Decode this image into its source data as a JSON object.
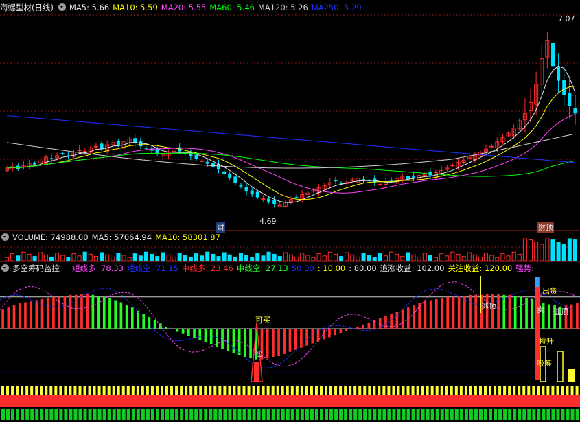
{
  "colors": {
    "up": "#ff2d2d",
    "down": "#00e0ff",
    "ma5": "#e8e8e8",
    "ma10": "#ffff00",
    "ma20": "#ff44ff",
    "ma60": "#00ff00",
    "ma120": "#cfcfcf",
    "ma250": "#2030ff",
    "grid": "#8a1a1a",
    "green": "#22ff22",
    "yellow": "#ffff33"
  },
  "price_panel": {
    "title": "海螺型材(日线)",
    "ma_items": [
      {
        "label": "MA5: 5.66",
        "color": "#e8e8e8"
      },
      {
        "label": "MA10: 5.59",
        "color": "#ffff00"
      },
      {
        "label": "MA20: 5.55",
        "color": "#ff44ff"
      },
      {
        "label": "MA60: 5.46",
        "color": "#00ff00"
      },
      {
        "label": "MA120: 5.26",
        "color": "#cfcfcf"
      },
      {
        "label": "MA250: 5.29",
        "color": "#2030ff"
      }
    ],
    "high_label": "7.07",
    "low_label": "4.69",
    "marker_left": "财",
    "marker_right": "财顶"
  },
  "volume_panel": {
    "items": [
      {
        "label": "VOLUME: 74988.00",
        "color": "#e6e6e6"
      },
      {
        "label": "MA5: 57064.94",
        "color": "#e6e6e6"
      },
      {
        "label": "MA10: 58301.87",
        "color": "#ffff00"
      }
    ]
  },
  "indicator_panel": {
    "title": "多空筹码监控",
    "items": [
      {
        "label": "短线多: 78.33",
        "color": "#ff44ff"
      },
      {
        "label": "短线空: 71.15",
        "color": "#2030ff"
      },
      {
        "label": "中线多: 23.46",
        "color": "#ff2d2d"
      },
      {
        "label": "中线空: 27.13",
        "color": "#22ff22"
      },
      {
        "label": "50.00",
        "color": "#2030ff"
      },
      {
        "label": ": 10.00",
        "color": "#ffff00"
      },
      {
        "label": ": 80.00",
        "color": "#e6e6e6"
      },
      {
        "label": "追涨收益: 102.00",
        "color": "#e6e6e6"
      },
      {
        "label": "关注收益: 120.00",
        "color": "#ffff00"
      },
      {
        "label": "强势:",
        "color": "#ff44ff"
      }
    ],
    "signals": {
      "buy_ok": "可买",
      "buy": "买",
      "escape_top": "逃顶",
      "sell_top": "出货",
      "sell": "卖",
      "escape_top2": "逃顶",
      "pull_up": "拉升",
      "absorb": "吸筹"
    }
  },
  "chart_data": [
    {
      "type": "candlestick",
      "title": "海螺型材(日线)",
      "ylim": [
        4.4,
        7.3
      ],
      "annotations": [
        {
          "text": "7.07",
          "value": 7.07
        },
        {
          "text": "4.69",
          "value": 4.69
        }
      ],
      "series": [
        {
          "name": "MA5",
          "last": 5.66
        },
        {
          "name": "MA10",
          "last": 5.59
        },
        {
          "name": "MA20",
          "last": 5.55
        },
        {
          "name": "MA60",
          "last": 5.46
        },
        {
          "name": "MA120",
          "last": 5.26
        },
        {
          "name": "MA250",
          "last": 5.29
        }
      ],
      "closes": [
        5.2,
        5.22,
        5.19,
        5.24,
        5.27,
        5.25,
        5.3,
        5.35,
        5.33,
        5.37,
        5.4,
        5.36,
        5.42,
        5.45,
        5.43,
        5.48,
        5.5,
        5.46,
        5.52,
        5.55,
        5.51,
        5.56,
        5.6,
        5.54,
        5.5,
        5.47,
        5.44,
        5.4,
        5.38,
        5.42,
        5.45,
        5.43,
        5.4,
        5.36,
        5.33,
        5.3,
        5.26,
        5.22,
        5.18,
        5.12,
        5.06,
        5.0,
        4.95,
        4.88,
        4.84,
        4.8,
        4.78,
        4.74,
        4.71,
        4.69,
        4.73,
        4.77,
        4.8,
        4.84,
        4.86,
        4.9,
        4.93,
        4.96,
        5.0,
        5.02,
        4.99,
        5.01,
        5.04,
        5.06,
        5.03,
        5.02,
        5.0,
        4.98,
        5.01,
        5.03,
        5.06,
        5.08,
        5.05,
        5.07,
        5.1,
        5.12,
        5.1,
        5.14,
        5.17,
        5.2,
        5.24,
        5.28,
        5.31,
        5.35,
        5.38,
        5.42,
        5.46,
        5.5,
        5.56,
        5.62,
        5.68,
        5.75,
        5.85,
        5.95,
        6.1,
        6.35,
        6.7,
        6.95,
        6.6,
        6.4,
        6.2,
        6.05,
        5.95
      ]
    },
    {
      "type": "bar",
      "title": "VOLUME",
      "series": [
        {
          "name": "VOLUME",
          "last": 74988.0
        },
        {
          "name": "MA5",
          "last": 57064.94
        },
        {
          "name": "MA10",
          "last": 58301.87
        }
      ]
    },
    {
      "type": "bar",
      "title": "多空筹码监控",
      "ylim": [
        0,
        100
      ],
      "series": [
        {
          "name": "短线多",
          "last": 78.33
        },
        {
          "name": "短线空",
          "last": 71.15
        },
        {
          "name": "中线多",
          "last": 23.46
        },
        {
          "name": "中线空",
          "last": 27.13
        }
      ],
      "reference_lines": [
        50,
        10,
        80
      ],
      "mid_values": [
        68,
        70,
        72,
        74,
        75,
        76,
        77,
        78,
        79,
        80,
        80,
        81,
        82,
        82,
        83,
        83,
        82,
        81,
        80,
        79,
        77,
        75,
        72,
        70,
        67,
        64,
        61,
        58,
        55,
        52,
        50,
        47,
        45,
        43,
        41,
        39,
        37,
        35,
        33,
        31,
        29,
        27,
        25,
        23,
        22,
        21,
        21,
        22,
        23,
        24,
        26,
        28,
        30,
        32,
        34,
        36,
        38,
        40,
        42,
        44,
        46,
        48,
        50,
        52,
        54,
        56,
        58,
        60,
        62,
        64,
        66,
        68,
        70,
        72,
        74,
        76,
        77,
        78,
        79,
        80,
        80,
        81,
        81,
        82,
        82,
        82,
        83,
        83,
        83,
        82,
        82,
        81,
        80,
        79,
        78,
        76,
        74,
        73,
        72,
        71,
        72,
        73,
        74
      ]
    }
  ]
}
